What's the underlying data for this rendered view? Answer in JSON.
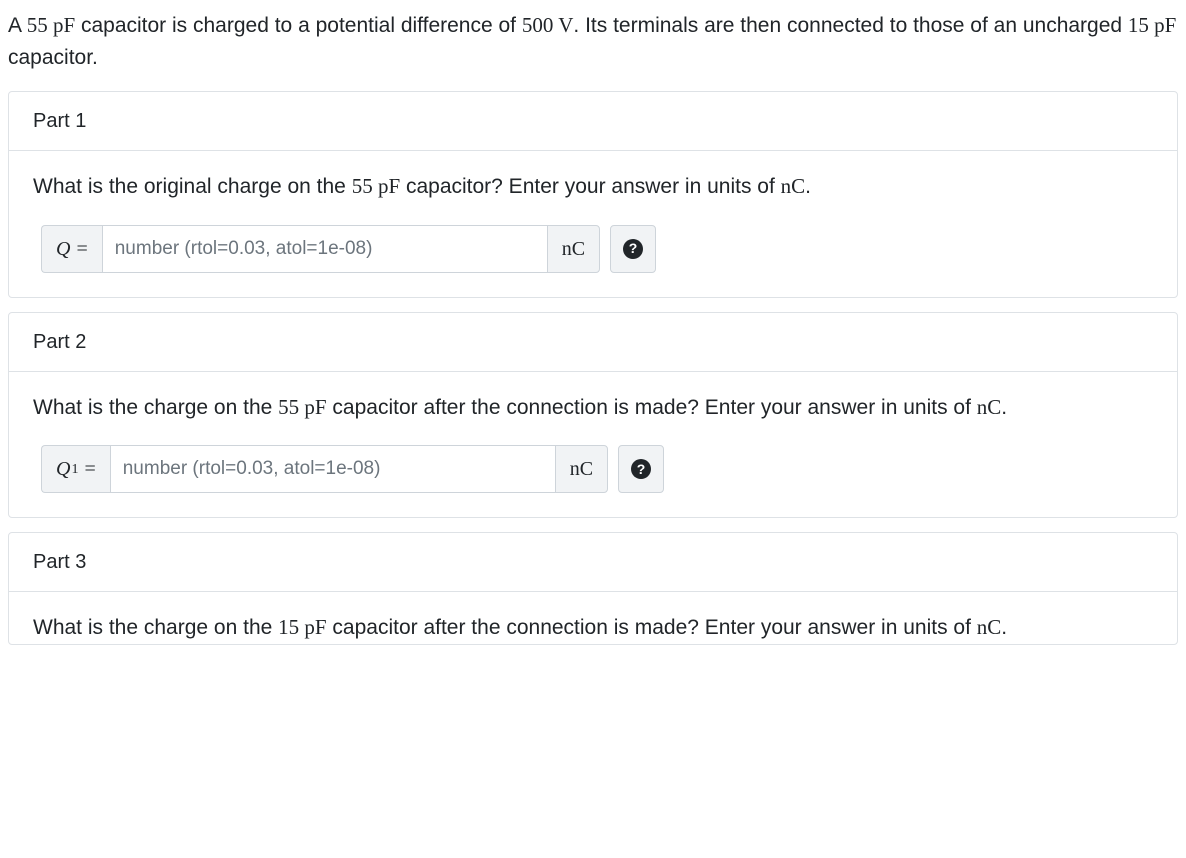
{
  "intro": {
    "t1": "A ",
    "v1": "55 pF",
    "t2": " capacitor is charged to a potential difference of ",
    "v2": "500 V",
    "t3": ". Its terminals are then connected to those of an uncharged ",
    "v3": "15 pF",
    "t4": " capacitor."
  },
  "parts": [
    {
      "header": "Part 1",
      "q_pre": "What is the original charge on the ",
      "q_val": "55 pF",
      "q_post": " capacitor? Enter your answer in units of ",
      "q_unit": "nC",
      "q_end": ".",
      "label_var": "Q",
      "label_sub": "",
      "label_eq": " =",
      "placeholder": "number (rtol=0.03, atol=1e-08)",
      "unit": "nC",
      "has_input": true
    },
    {
      "header": "Part 2",
      "q_pre": "What is the charge on the ",
      "q_val": "55 pF",
      "q_post": " capacitor after the connection is made? Enter your answer in units of ",
      "q_unit": "nC",
      "q_end": ".",
      "label_var": "Q",
      "label_sub": "1",
      "label_eq": " =",
      "placeholder": "number (rtol=0.03, atol=1e-08)",
      "unit": "nC",
      "has_input": true
    },
    {
      "header": "Part 3",
      "q_pre": "What is the charge on the ",
      "q_val": "15 pF",
      "q_post": " capacitor after the connection is made? Enter your answer in units of ",
      "q_unit": "nC",
      "q_end": ".",
      "has_input": false
    }
  ],
  "help_glyph": "?"
}
